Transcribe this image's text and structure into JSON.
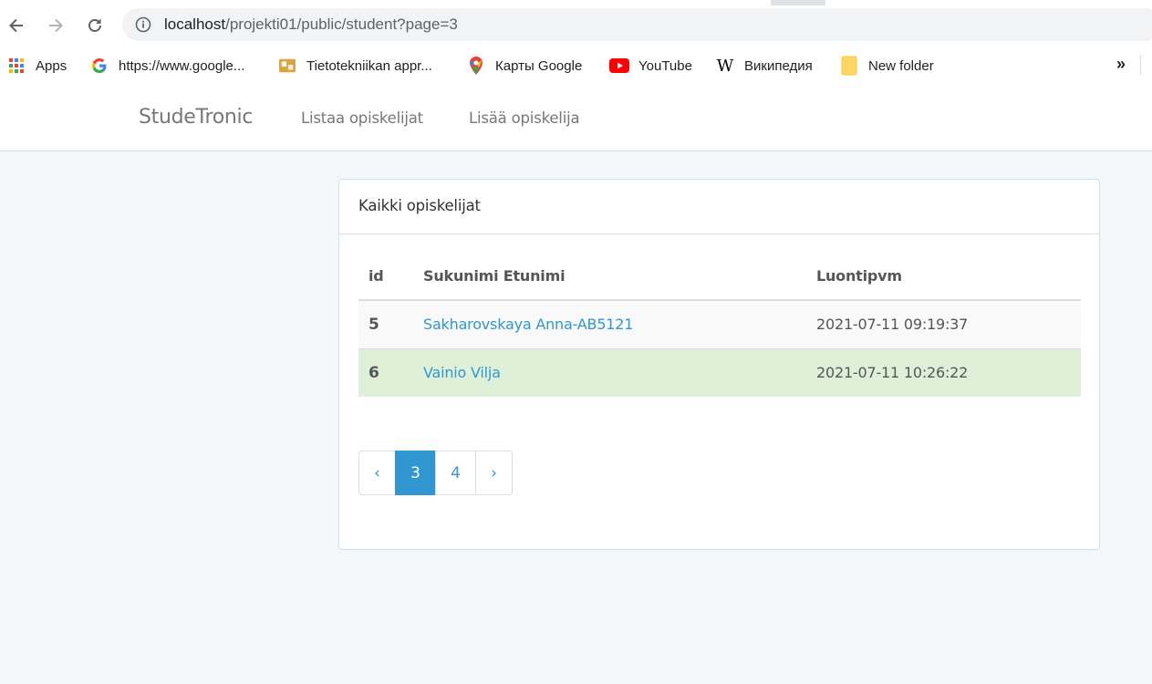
{
  "browser": {
    "url_host": "localhost",
    "url_path": "/projekti01/public/student?page=3",
    "bookmarks": [
      {
        "label": "Apps",
        "icon": "apps-grid-icon"
      },
      {
        "label": "https://www.google...",
        "icon": "google-icon"
      },
      {
        "label": "Tietotekniikan appr...",
        "icon": "bookmark-site-icon"
      },
      {
        "label": "Карты Google",
        "icon": "google-maps-icon"
      },
      {
        "label": "YouTube",
        "icon": "youtube-icon"
      },
      {
        "label": "Википедия",
        "icon": "wikipedia-icon"
      },
      {
        "label": "New folder",
        "icon": "folder-icon"
      }
    ],
    "more": "»"
  },
  "navbar": {
    "brand": "StudeTronic",
    "links": [
      "Listaa opiskelijat",
      "Lisää opiskelija"
    ]
  },
  "panel": {
    "heading": "Kaikki opiskelijat",
    "columns": [
      "id",
      "Sukunimi Etunimi",
      "Luontipvm"
    ],
    "rows": [
      {
        "id": "5",
        "name": "Sakharovskaya Anna-AB5121",
        "date": "2021-07-11 09:19:37"
      },
      {
        "id": "6",
        "name": "Vainio Vilja",
        "date": "2021-07-11 10:26:22"
      }
    ],
    "pagination": {
      "prev": "‹",
      "pages": [
        "3",
        "4"
      ],
      "active": "3",
      "next": "›"
    }
  },
  "colors": {
    "accent": "#3097d1",
    "success_row": "#dff0d8",
    "page_bg": "#f5f8fa"
  }
}
